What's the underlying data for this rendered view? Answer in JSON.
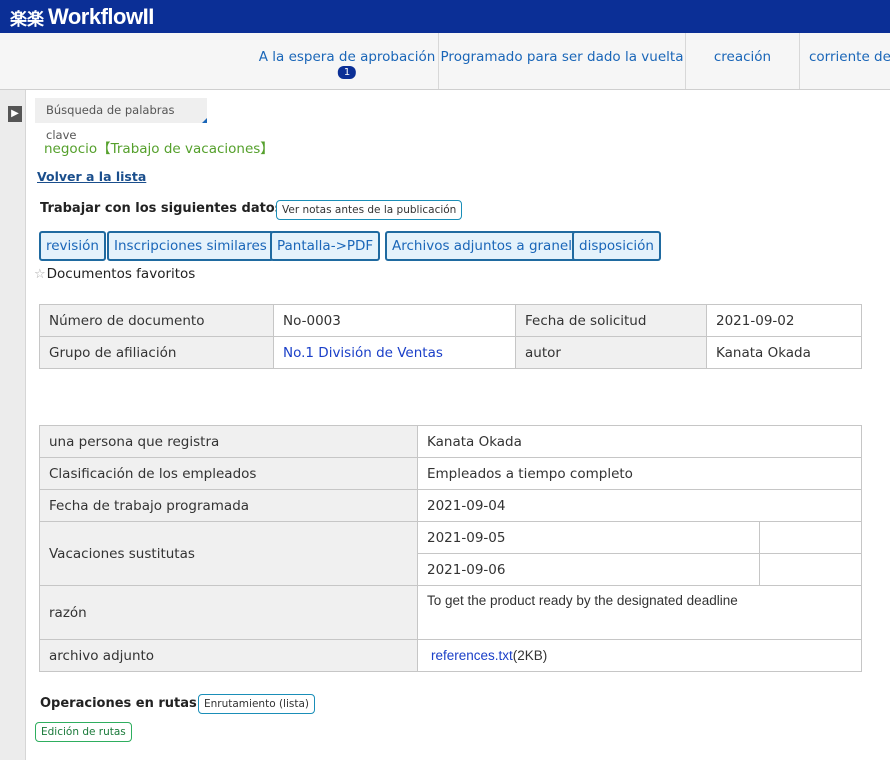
{
  "app": {
    "logo_kanji": "楽楽",
    "logo_text": "WorkflowII"
  },
  "nav": {
    "tabs": [
      {
        "label": "A la espera de aprobación",
        "badge": "1"
      },
      {
        "label": "Programado para ser dado la vuelta"
      },
      {
        "label": "creación"
      },
      {
        "label": "corriente de"
      }
    ]
  },
  "sidebar": {
    "toggle_glyph": "▶"
  },
  "search": {
    "keyword_tab": "Búsqueda de palabras clave"
  },
  "document": {
    "title": "negocio【Trabajo de vacaciones】",
    "back_link": "Volver a la lista",
    "work_with_label": "Trabajar con los siguientes datos:",
    "view_notes_button": "Ver notas antes de la publicación",
    "actions": [
      "revisión",
      "Inscripciones similares",
      "Pantalla->PDF",
      "Archivos adjuntos a granel",
      "disposición"
    ],
    "favorites_label": "Documentos favoritos",
    "favorites_icon": "star-outline-icon"
  },
  "header_table": {
    "rows": [
      [
        "Número de documento",
        "No-0003",
        "Fecha de solicitud",
        "2021-09-02"
      ],
      [
        "Grupo de afiliación",
        "No.1 División de Ventas",
        "autor",
        "Kanata Okada"
      ]
    ]
  },
  "detail_table": {
    "registrant_label": "una persona que registra",
    "registrant_value": "Kanata Okada",
    "classification_label": "Clasificación de los empleados",
    "classification_value": "Empleados a tiempo completo",
    "scheduled_label": "Fecha de trabajo programada",
    "scheduled_value": "2021-09-04",
    "substitute_label": "Vacaciones sustitutas",
    "substitute_values": [
      "2021-09-05",
      "2021-09-06"
    ],
    "reason_label": "razón",
    "reason_value": "To get  the product ready by the designated deadline",
    "attachment_label": "archivo adjunto",
    "attachment_file": "references.txt",
    "attachment_size": "(2KB)"
  },
  "route_ops": {
    "label": "Operaciones en rutas:",
    "routing_button": "Enrutamiento (lista)",
    "edit_button": "Edición de rutas"
  }
}
